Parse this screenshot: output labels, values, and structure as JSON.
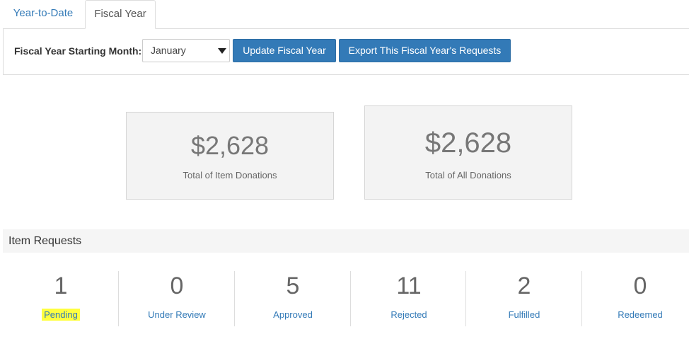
{
  "tabs": [
    {
      "label": "Year-to-Date",
      "active": false
    },
    {
      "label": "Fiscal Year",
      "active": true
    }
  ],
  "fiscal": {
    "label": "Fiscal Year Starting Month:",
    "selected_month": "January",
    "update_button": "Update Fiscal Year",
    "export_button": "Export This Fiscal Year's Requests"
  },
  "stats": [
    {
      "value": "$2,628",
      "caption": "Total of Item Donations"
    },
    {
      "value": "$2,628",
      "caption": "Total of All Donations"
    }
  ],
  "item_requests": {
    "title": "Item Requests",
    "statuses": [
      {
        "count": "1",
        "label": "Pending",
        "highlighted": true
      },
      {
        "count": "0",
        "label": "Under Review"
      },
      {
        "count": "5",
        "label": "Approved"
      },
      {
        "count": "11",
        "label": "Rejected"
      },
      {
        "count": "2",
        "label": "Fulfilled"
      },
      {
        "count": "0",
        "label": "Redeemed"
      }
    ]
  },
  "colors": {
    "link": "#337ab7",
    "button": "#337ab7",
    "highlight": "#ffff3f",
    "card_bg": "#f3f3f3"
  }
}
